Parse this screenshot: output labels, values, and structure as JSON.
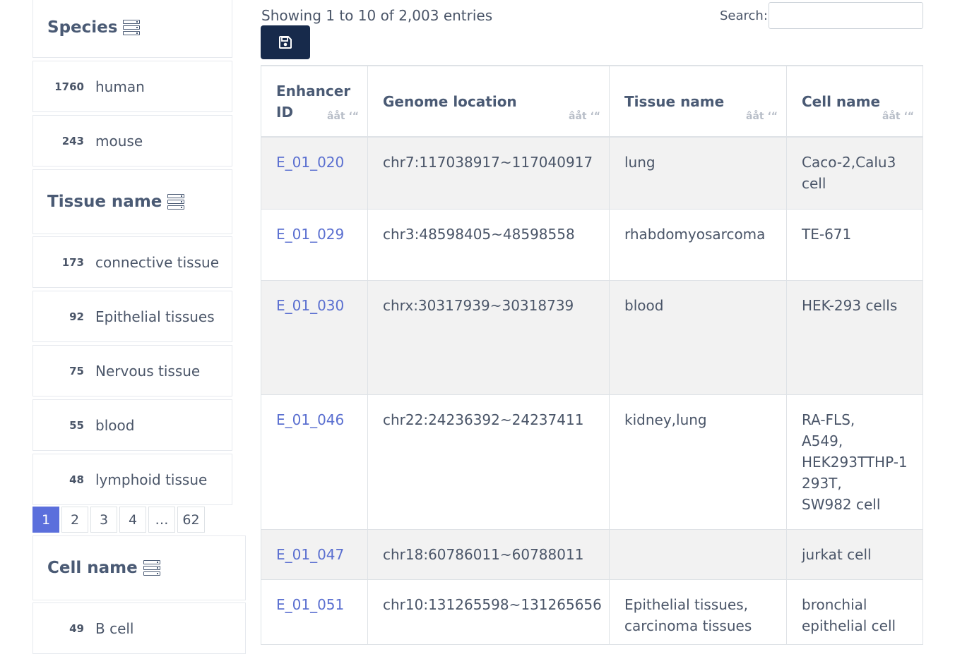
{
  "facets": {
    "species": {
      "title": "Species",
      "items": [
        {
          "count": "1760",
          "label": "human"
        },
        {
          "count": "243",
          "label": "mouse"
        }
      ]
    },
    "tissue": {
      "title": "Tissue name",
      "items": [
        {
          "count": "173",
          "label": "connective tissue"
        },
        {
          "count": "92",
          "label": "Epithelial tissues"
        },
        {
          "count": "75",
          "label": "Nervous tissue"
        },
        {
          "count": "55",
          "label": "blood"
        },
        {
          "count": "48",
          "label": "lymphoid tissue"
        }
      ],
      "pages": [
        "1",
        "2",
        "3",
        "4",
        "…",
        "62"
      ]
    },
    "cell": {
      "title": "Cell name",
      "items": [
        {
          "count": "49",
          "label": "B cell"
        }
      ]
    }
  },
  "table_info": "Showing 1 to 10 of 2,003 entries",
  "search": {
    "label": "Search:",
    "value": ""
  },
  "save_icon": "save-icon",
  "columns": [
    "Enhancer ID",
    "Genome location",
    "Tissue name",
    "Cell name"
  ],
  "sort_glyph": "âåt ‘“",
  "rows": [
    {
      "id": "E_01_020",
      "location": "chr7:117038917~117040917",
      "tissue": "lung",
      "cell": "Caco-2,Calu3 cell"
    },
    {
      "id": "E_01_029",
      "location": "chr3:48598405~48598558",
      "tissue": "rhabdomyosarcoma",
      "cell": "TE-671"
    },
    {
      "id": "E_01_030",
      "location": "chrx:30317939~30318739",
      "tissue": "blood",
      "cell": "HEK-293 cells"
    },
    {
      "id": "E_01_046",
      "location": "chr22:24236392~24237411",
      "tissue": "kidney,lung",
      "cell": "RA-FLS,\nA549,\nHEK293TTHP-1293T,\nSW982 cell"
    },
    {
      "id": "E_01_047",
      "location": "chr18:60786011~60788011",
      "tissue": "",
      "cell": "jurkat cell"
    },
    {
      "id": "E_01_051",
      "location": "chr10:131265598~131265656",
      "tissue": "Epithelial tissues, carcinoma tissues",
      "cell": "bronchial epithelial cell"
    }
  ],
  "colors": {
    "accent": "#5b6fdc",
    "link": "#5a6fd0",
    "button": "#172a4b",
    "text": "#4a5568"
  }
}
